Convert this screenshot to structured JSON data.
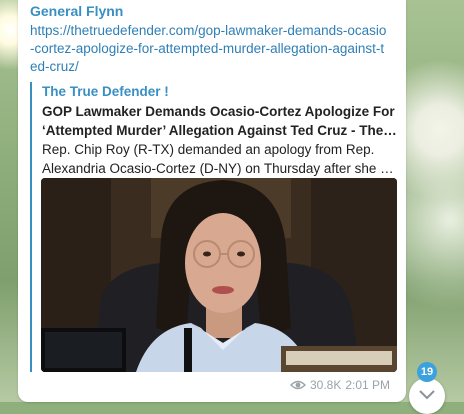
{
  "message": {
    "sender": "General Flynn",
    "link_text": "https://thetruedefender.com/gop-lawmaker-demands-ocasio-cortez-apologize-for-attempted-murder-allegation-against-ted-cruz/",
    "preview": {
      "site_name": "The True Defender !",
      "title_line1": "GOP Lawmaker Demands Ocasio-Cortez Apologize For",
      "title_line2": "‘Attempted Murder’ Allegation Against Ted Cruz - The Tr...",
      "desc_line1": "Rep. Chip Roy (R-TX) demanded an apology from Rep.",
      "desc_line2": "Alexandria Ocasio-Cortez (D-NY) on Thursday after she acc..."
    },
    "views": "30.8K",
    "time": "2:01 PM"
  },
  "unread_badge": "19",
  "icons": {
    "views": "eye-icon",
    "scroll": "chevron-down-icon"
  },
  "colors": {
    "accent": "#3a8fc2",
    "badge": "#3ca2dd",
    "meta": "#9aa3ab"
  }
}
